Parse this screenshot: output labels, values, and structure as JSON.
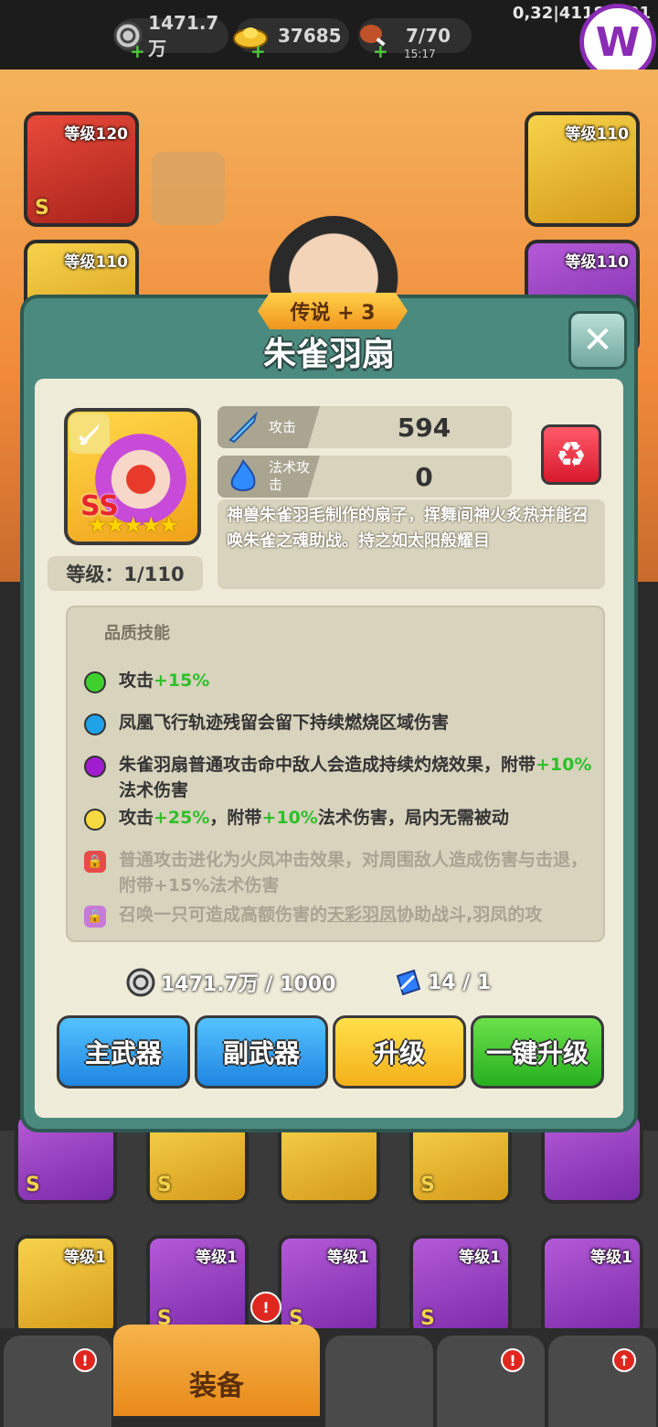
{
  "topbar": {
    "silver": "1471.7万",
    "gold": "37685",
    "stamina": "7/70",
    "stamina_timer": "15:17",
    "coords": "0,32|41181521",
    "logo_letter": "W"
  },
  "scene": {
    "slots": [
      "等级120",
      "等级110",
      "等级110",
      "等级110"
    ]
  },
  "modal": {
    "rarity": "传说 + 3",
    "title": "朱雀羽扇",
    "item": {
      "grade": "SS",
      "stars": "★★★★★",
      "level_text": "等级：1/110"
    },
    "stats": [
      {
        "name": "攻击",
        "value": "594"
      },
      {
        "name": "法术攻击",
        "value": "0"
      }
    ],
    "description": "神兽朱雀羽毛制作的扇子，挥舞间神火炙热并能召唤朱雀之魂助战。持之如太阳般耀目",
    "skills_header": "品质技能",
    "skills": [
      {
        "color": "#3fd02e",
        "parts": [
          "攻击",
          "+15%"
        ]
      },
      {
        "color": "#1fa2e8",
        "text": "凤凰飞行轨迹残留会留下持续燃烧区域伤害"
      },
      {
        "color": "#a21ccf",
        "parts": [
          "朱雀羽扇普通攻击命中敌人会造成持续灼烧效果，附带",
          "+10%",
          "法术伤害"
        ]
      },
      {
        "color": "#f7d940",
        "parts": [
          "攻击",
          "+25%",
          "，附带",
          "+10%",
          "法术伤害，局内无需被动"
        ]
      },
      {
        "locked": true,
        "text": "普通攻击进化为火凤冲击效果，对周围敌人造成伤害与击退，附带+15%法术伤害"
      },
      {
        "locked": true,
        "parts": [
          "召唤一只可造成高额伤害的",
          "天彩羽凤",
          "协助战斗,羽凤的攻"
        ]
      }
    ],
    "cost_silver": "1471.7万 / 1000",
    "cost_stone": "14 / 1",
    "buttons": {
      "main": "主武器",
      "sub": "副武器",
      "upgrade": "升级",
      "oneclick": "一键升级"
    }
  },
  "bottom": {
    "slots": [
      "等级1",
      "等级1",
      "等级1",
      "等级1",
      "等级1"
    ],
    "active_tab": "装备"
  },
  "colors": {
    "modal_frame": "#4b8a7e",
    "panel": "#efebd9",
    "green_text": "#2fbf2a",
    "btn_blue": "#1f86e0",
    "btn_yellow": "#f4b01a",
    "btn_green": "#27b01f"
  }
}
